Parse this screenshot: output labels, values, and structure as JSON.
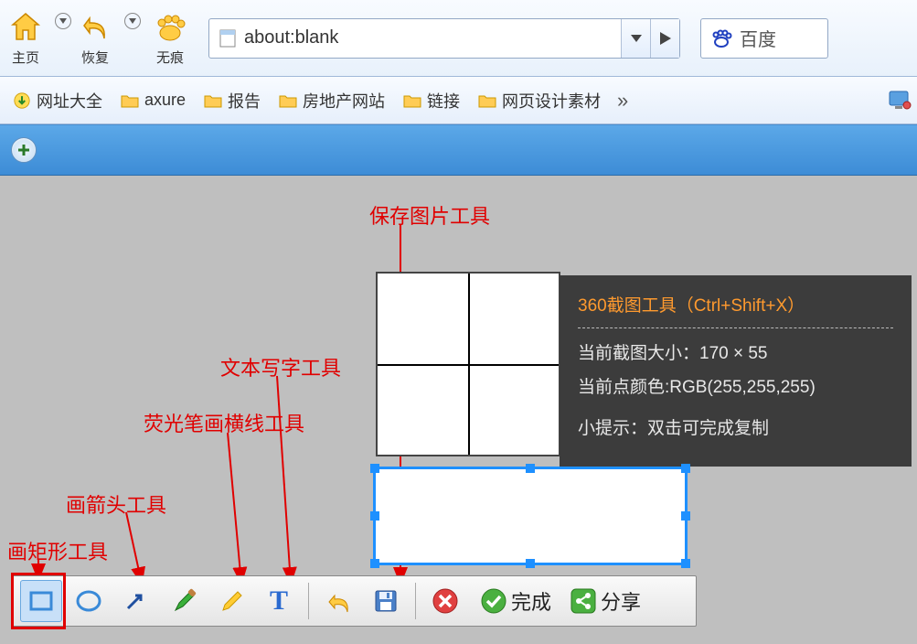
{
  "top_toolbar": {
    "home_label": "主页",
    "restore_label": "恢复",
    "incognito_label": "无痕"
  },
  "address_bar": {
    "url": "about:blank"
  },
  "search": {
    "engine_name": "百度"
  },
  "bookmarks": {
    "items": [
      {
        "icon": "green",
        "label": "网址大全"
      },
      {
        "icon": "folder",
        "label": "axure"
      },
      {
        "icon": "folder",
        "label": "报告"
      },
      {
        "icon": "folder",
        "label": "房地产网站"
      },
      {
        "icon": "folder",
        "label": "链接"
      },
      {
        "icon": "folder",
        "label": "网页设计素材"
      }
    ],
    "overflow": "»"
  },
  "annotations": {
    "save_tool": "保存图片工具",
    "text_tool": "文本写字工具",
    "highlight_tool": "荧光笔画横线工具",
    "arrow_tool": "画箭头工具",
    "rect_tool": "画矩形工具"
  },
  "screenshot_info": {
    "title": "360截图工具（Ctrl+Shift+X）",
    "size_line": "当前截图大小：170 × 55",
    "color_line": "当前点颜色:RGB(255,255,255)",
    "hint_line": "小提示：双击可完成复制"
  },
  "toolbar_actions": {
    "done_label": "完成",
    "share_label": "分享"
  }
}
